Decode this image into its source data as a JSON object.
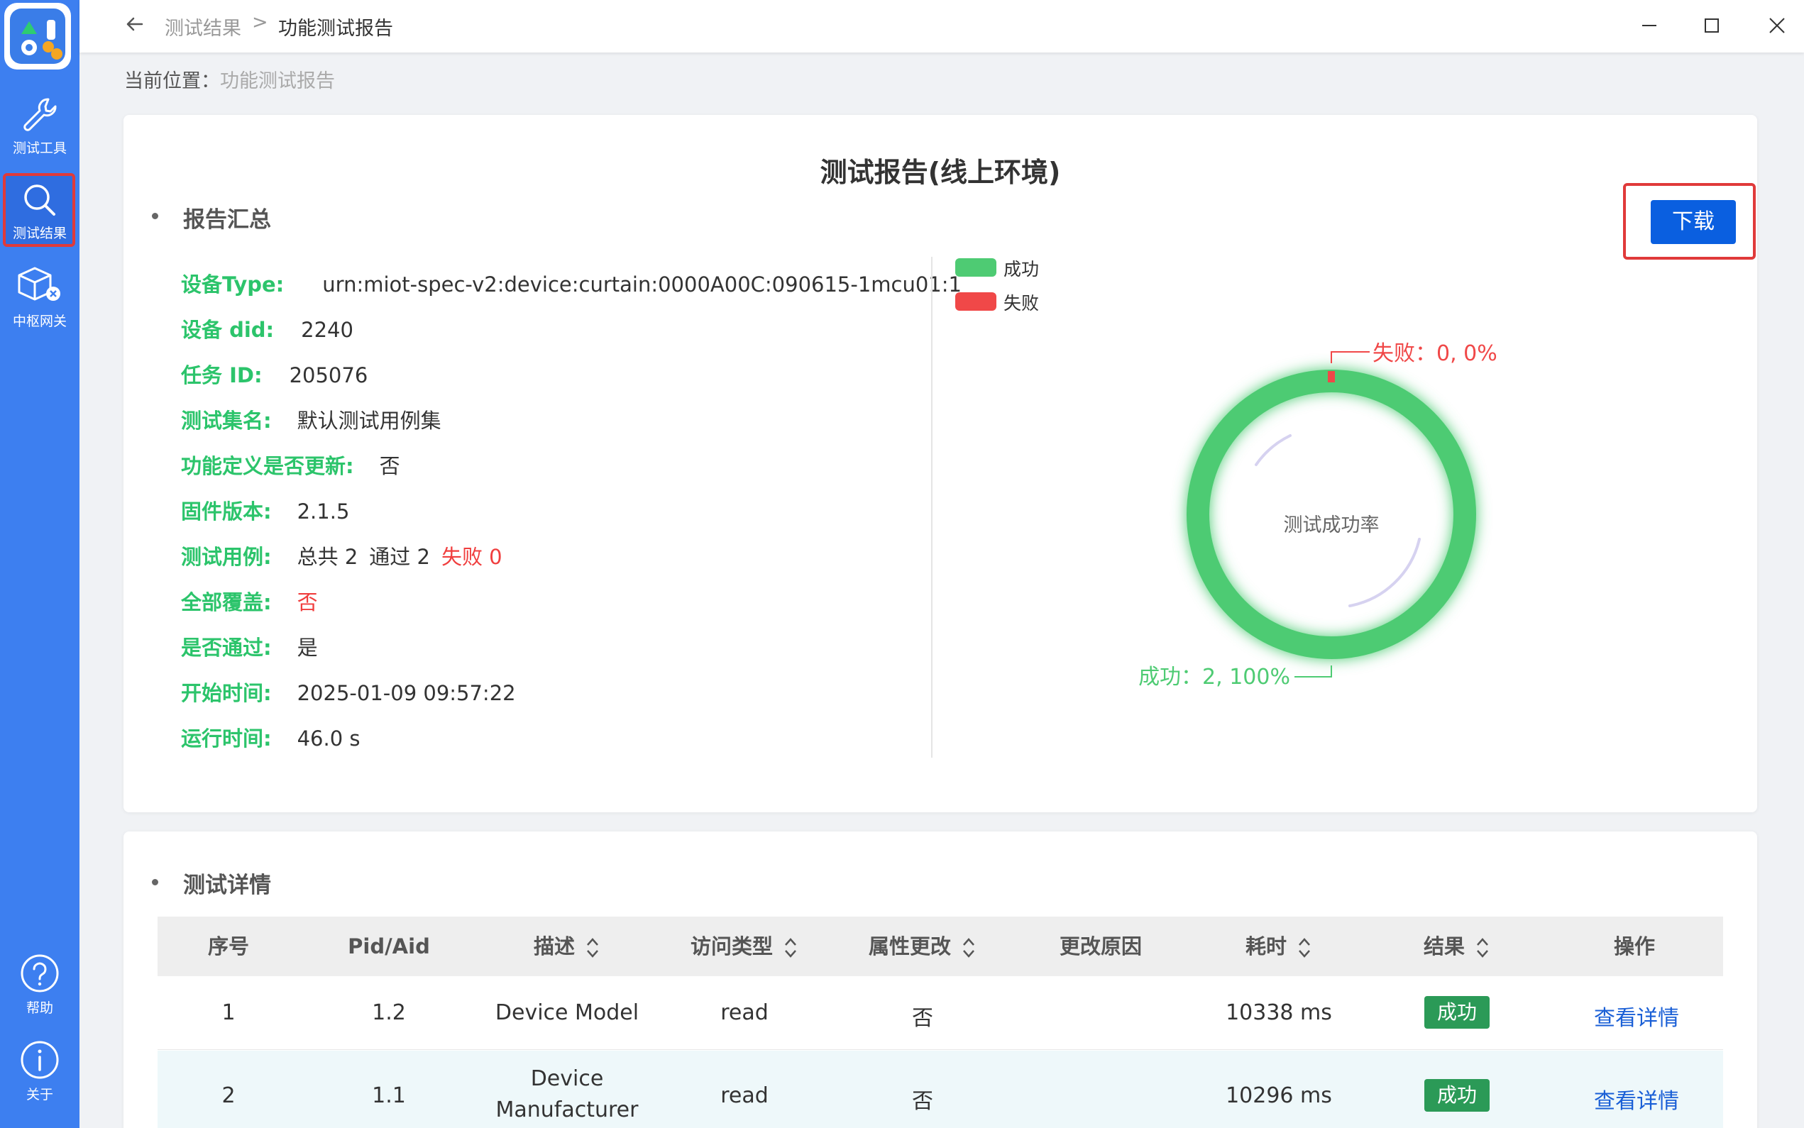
{
  "sidebar": {
    "items": [
      {
        "label": "测试工具",
        "icon": "wrench-icon"
      },
      {
        "label": "测试结果",
        "icon": "search-icon"
      },
      {
        "label": "中枢网关",
        "icon": "cube-icon"
      },
      {
        "label": "帮助",
        "icon": "help-icon"
      },
      {
        "label": "关于",
        "icon": "info-icon"
      }
    ]
  },
  "header": {
    "crumb1": "测试结果",
    "sep": ">",
    "crumb2": "功能测试报告"
  },
  "location": {
    "label": "当前位置：",
    "value": "功能测试报告"
  },
  "report": {
    "title": "测试报告(线上环境)",
    "summary_title": "报告汇总",
    "download": "下载",
    "fields": {
      "device_type_label": "设备Type:",
      "device_type": "urn:miot-spec-v2:device:curtain:0000A00C:090615-1mcu01:1",
      "did_label": "设备 did:",
      "did": "2240",
      "task_label": "任务 ID:",
      "task": "205076",
      "set_label": "测试集名:",
      "set": "默认测试用例集",
      "updated_label": "功能定义是否更新:",
      "updated": "否",
      "fw_label": "固件版本:",
      "fw": "2.1.5",
      "cases_label": "测试用例:",
      "cases_total": "总共 2",
      "cases_pass": "通过 2",
      "cases_fail": "失败 0",
      "coverage_label": "全部覆盖:",
      "coverage": "否",
      "passed_label": "是否通过:",
      "passed": "是",
      "start_label": "开始时间:",
      "start": "2025-01-09 09:57:22",
      "run_label": "运行时间:",
      "run": "46.0 s"
    }
  },
  "chart_data": {
    "type": "pie",
    "title": "测试成功率",
    "legend": [
      "成功",
      "失败"
    ],
    "slices": [
      {
        "name": "成功",
        "value": 2,
        "percent": 100,
        "color": "#4ecb73"
      },
      {
        "name": "失败",
        "value": 0,
        "percent": 0,
        "color": "#f04848"
      }
    ],
    "labels": {
      "fail": "失败：0, 0%",
      "success": "成功：2, 100%"
    }
  },
  "details": {
    "title": "测试详情",
    "columns": [
      "序号",
      "Pid/Aid",
      "描述",
      "访问类型",
      "属性更改",
      "更改原因",
      "耗时",
      "结果",
      "操作"
    ],
    "rows": [
      {
        "idx": "1",
        "pid": "1.2",
        "desc": "Device Model",
        "desc2": "",
        "access": "read",
        "changed": "否",
        "reason": "",
        "time": "10338 ms",
        "result": "成功",
        "action": "查看详情"
      },
      {
        "idx": "2",
        "pid": "1.1",
        "desc": "Device",
        "desc2": "Manufacturer",
        "access": "read",
        "changed": "否",
        "reason": "",
        "time": "10296 ms",
        "result": "成功",
        "action": "查看详情"
      }
    ]
  }
}
